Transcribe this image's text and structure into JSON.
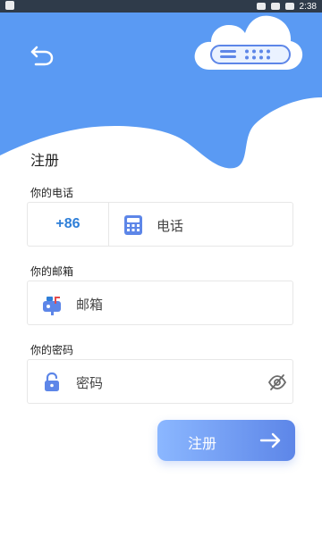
{
  "status_bar": {
    "time": "2:38"
  },
  "header": {
    "title": "注册"
  },
  "form": {
    "phone": {
      "label": "你的电话",
      "country_code": "+86",
      "placeholder": "电话"
    },
    "email": {
      "label": "你的邮箱",
      "placeholder": "邮箱"
    },
    "password": {
      "label": "你的密码",
      "placeholder": "密码"
    }
  },
  "actions": {
    "register_label": "注册"
  },
  "colors": {
    "accent_blue": "#5d86e8",
    "hero_blue": "#5a9af3",
    "country_code_blue": "#2f7fd8"
  },
  "icons": {
    "back": "back-arrow-icon",
    "cloud": "cloud-server-icon",
    "phone": "phone-icon",
    "email": "mailbox-icon",
    "lock": "lock-icon",
    "eye": "eye-off-icon",
    "arrow": "arrow-right-icon"
  }
}
